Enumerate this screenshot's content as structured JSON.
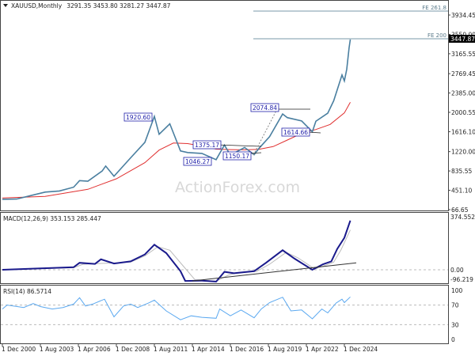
{
  "header": {
    "symbol": "XAUUSD,Monthly",
    "ohlc": "3291.35 3453.80 3281.27 3447.87"
  },
  "watermark": "ActionForex.com",
  "colors": {
    "price": "#4a7fa0",
    "sma": "#e03030",
    "macd": "#1a1a8c",
    "signal": "#bbbbbb",
    "rsi": "#5aa8f0",
    "label_border": "#2222aa",
    "fe_line": "#7a9aa8"
  },
  "chart_data": [
    {
      "type": "line",
      "title": "XAUUSD,Monthly 3291.35 3453.80 3281.27 3447.87",
      "y_ticks": [
        3934.45,
        3550.0,
        3165.55,
        2769.45,
        2385.0,
        2000.55,
        1616.1,
        1220.0,
        835.55,
        451.1,
        66.65
      ],
      "y_tick_labels": [
        "3934.45",
        "3550.00",
        "3165.55",
        "2769.45",
        "2385.00",
        "2000.55",
        "1616.10",
        "1220.00",
        "835.55",
        "451.10",
        "66.65"
      ],
      "ylim": [
        66.65,
        3934.45
      ],
      "x_tick_labels": [
        "1 Dec 2000",
        "1 Aug 2003",
        "1 Apr 2006",
        "1 Dec 2008",
        "1 Aug 2011",
        "1 Apr 2014",
        "1 Dec 2016",
        "1 Aug 2019",
        "1 Apr 2022",
        "1 Dec 2024"
      ],
      "x_ticks": [
        "2000-12",
        "2003-08",
        "2006-04",
        "2008-12",
        "2011-08",
        "2014-04",
        "2016-12",
        "2019-08",
        "2022-04",
        "2024-12"
      ],
      "current_price_label": "3447.87",
      "series": [
        {
          "x": [
            "2000-12",
            "2001-12",
            "2002-12",
            "2003-12",
            "2004-12",
            "2005-12",
            "2006-05",
            "2006-12",
            "2007-12",
            "2008-03",
            "2008-10",
            "2009-12",
            "2010-12",
            "2011-08",
            "2011-12",
            "2012-09",
            "2013-06",
            "2013-12",
            "2014-12",
            "2015-12",
            "2016-07",
            "2016-12",
            "2017-12",
            "2018-08",
            "2018-12",
            "2019-09",
            "2020-08",
            "2020-12",
            "2021-12",
            "2022-09",
            "2022-12",
            "2023-10",
            "2024-03",
            "2024-10",
            "2024-12",
            "2025-02",
            "2025-04",
            "2025-05"
          ],
          "y": [
            272,
            277,
            347,
            416,
            438,
            513,
            643,
            632,
            834,
            933,
            730,
            1096,
            1405,
            1920,
            1565,
            1772,
            1234,
            1202,
            1184,
            1061,
            1351,
            1152,
            1303,
            1160,
            1282,
            1517,
            1968,
            1895,
            1829,
            1614,
            1824,
            1983,
            2230,
            2744,
            2625,
            2857,
            3288,
            3447.87
          ]
        },
        {
          "x": [
            "2000-12",
            "2003-12",
            "2006-12",
            "2008-12",
            "2010-12",
            "2011-12",
            "2012-12",
            "2013-12",
            "2014-12",
            "2015-12",
            "2016-12",
            "2017-12",
            "2018-12",
            "2019-12",
            "2020-12",
            "2021-12",
            "2022-12",
            "2023-12",
            "2024-12",
            "2025-05"
          ],
          "y": [
            300,
            330,
            470,
            680,
            1000,
            1250,
            1390,
            1380,
            1330,
            1270,
            1260,
            1255,
            1265,
            1320,
            1450,
            1580,
            1660,
            1760,
            1990,
            2200
          ]
        }
      ],
      "annotations": [
        "1920.60",
        "1375.17",
        "1046.27",
        "1150.17",
        "2074.84",
        "1614.66"
      ],
      "levels": [
        {
          "label": "FE 261.8",
          "value": 3980
        },
        {
          "label": "FE 200",
          "value": 3450
        }
      ]
    },
    {
      "type": "line",
      "title": "MACD(12,26,9) 353.153 285.447",
      "y_tick_labels": [
        "374.552",
        "0.00",
        "-96.219"
      ],
      "ylim": [
        -96.219,
        374.552
      ],
      "series": [
        {
          "x": [
            "2000-12",
            "2003-08",
            "2005-12",
            "2006-05",
            "2007-06",
            "2007-11",
            "2008-10",
            "2009-12",
            "2010-12",
            "2011-08",
            "2012-06",
            "2013-06",
            "2013-10",
            "2014-12",
            "2015-12",
            "2016-07",
            "2017-03",
            "2018-08",
            "2019-06",
            "2020-08",
            "2021-06",
            "2022-09",
            "2023-06",
            "2024-01",
            "2024-06",
            "2024-12",
            "2025-05"
          ],
          "y": [
            0,
            10,
            18,
            50,
            42,
            75,
            45,
            60,
            110,
            180,
            120,
            -10,
            -80,
            -78,
            -85,
            -15,
            -25,
            -10,
            50,
            140,
            80,
            0,
            40,
            60,
            150,
            230,
            353.153
          ]
        },
        {
          "x": [
            "2000-12",
            "2003-08",
            "2005-12",
            "2006-08",
            "2007-09",
            "2008-12",
            "2009-12",
            "2010-12",
            "2011-11",
            "2012-09",
            "2013-09",
            "2014-06",
            "2015-12",
            "2016-10",
            "2017-06",
            "2018-10",
            "2019-09",
            "2020-11",
            "2021-09",
            "2022-11",
            "2023-09",
            "2024-03",
            "2024-09",
            "2025-05"
          ],
          "y": [
            0,
            8,
            15,
            40,
            45,
            50,
            55,
            100,
            165,
            140,
            20,
            -70,
            -82,
            -40,
            -20,
            -12,
            40,
            125,
            85,
            5,
            35,
            55,
            140,
            285.447
          ]
        },
        {
          "x": [
            "2014-04",
            "2025-10"
          ],
          "y": [
            -80,
            50
          ]
        }
      ]
    },
    {
      "type": "line",
      "title": "RSI(14) 86.5714",
      "y_tick_labels": [
        "100",
        "70",
        "30",
        "0"
      ],
      "ylim": [
        0,
        100
      ],
      "series": [
        {
          "x": [
            "2000-12",
            "2001-04",
            "2002-06",
            "2003-02",
            "2003-08",
            "2004-06",
            "2005-03",
            "2005-12",
            "2006-05",
            "2006-10",
            "2007-04",
            "2008-02",
            "2008-10",
            "2009-06",
            "2009-12",
            "2010-06",
            "2011-03",
            "2011-08",
            "2012-06",
            "2013-06",
            "2014-03",
            "2014-12",
            "2015-12",
            "2016-03",
            "2016-12",
            "2017-09",
            "2018-08",
            "2019-02",
            "2019-09",
            "2020-08",
            "2021-03",
            "2021-12",
            "2022-09",
            "2023-05",
            "2023-10",
            "2024-05",
            "2024-10",
            "2024-12",
            "2025-05"
          ],
          "y": [
            62,
            70,
            65,
            73,
            67,
            62,
            65,
            72,
            85,
            68,
            72,
            82,
            46,
            68,
            72,
            65,
            74,
            80,
            58,
            40,
            48,
            45,
            43,
            62,
            48,
            60,
            44,
            62,
            75,
            86,
            58,
            60,
            42,
            62,
            54,
            74,
            82,
            75,
            86.5714
          ]
        }
      ]
    }
  ]
}
